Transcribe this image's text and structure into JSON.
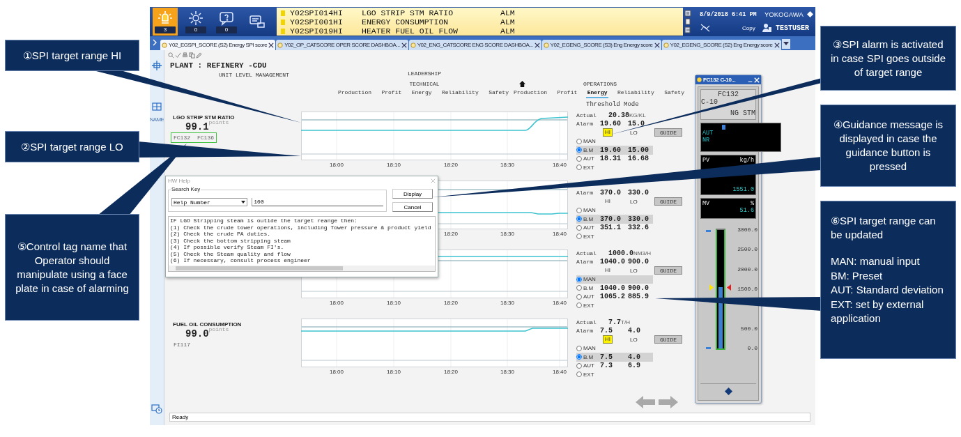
{
  "callouts": [
    {
      "text": "①SPI target range HI"
    },
    {
      "text": "②SPI target range LO"
    },
    {
      "text": "⑤Control tag name that Operator should manipulate using a face plate in case of alarming"
    },
    {
      "text": "③SPI alarm is activated in case SPI goes outside of target range"
    },
    {
      "text": "④Guidance message is displayed in case the guidance button is pressed"
    },
    {
      "text": "⑥SPI target range can be updated",
      "notes": [
        "MAN: manual input",
        "BM: Preset",
        "AUT: Standard deviation",
        "EXT: set by external application"
      ]
    }
  ],
  "alarm_buttons": [
    {
      "kind": "lamp",
      "count": "3",
      "active": true
    },
    {
      "kind": "sun",
      "count": "0",
      "active": false
    },
    {
      "kind": "help",
      "count": "0",
      "active": false
    },
    {
      "kind": "screen",
      "active": false
    }
  ],
  "alarms": [
    {
      "tag": "Y02SPI014HI",
      "description": "LGO STRIP STM RATIO",
      "status": "ALM"
    },
    {
      "tag": "Y02SPI001HI",
      "description": "ENERGY CONSUMPTION",
      "status": "ALM"
    },
    {
      "tag": "Y02SPI019HI",
      "description": "HEATER FUEL OIL FLOW",
      "status": "ALM"
    }
  ],
  "datetime": "8/9/2018 6:41 PM",
  "brand": "YOKOGAWA",
  "copy": "Copy",
  "user": "TESTUSER",
  "tabs": [
    {
      "label": "Y02_EGSPI_SCORE (S2) Energy SPI score",
      "selected": true
    },
    {
      "label": "Y02_OP_CATSCORE OPER SCORE DASHBOA...",
      "selected": false
    },
    {
      "label": "Y02_ENG_CATSCORE ENG SCORE DASHBOA...",
      "selected": false
    },
    {
      "label": "Y02_EGENG_SCORE (S3) Eng Energy score",
      "selected": false
    },
    {
      "label": "Y02_EGENG_SCORE (S2) Eng Energy score",
      "selected": false
    }
  ],
  "sidebar_label": "NAME",
  "header": {
    "plant": "PLANT : REFINERY -CDU",
    "subtitle": "UNIT LEVEL MANAGEMENT",
    "leadership": "LEADERSHIP",
    "groups": [
      {
        "label": "TECHNICAL",
        "items": [
          {
            "label": "Production",
            "selected": false
          },
          {
            "label": "Profit",
            "selected": false
          },
          {
            "label": "Energy",
            "selected": false
          },
          {
            "label": "Reliability",
            "selected": false
          },
          {
            "label": "Safety",
            "selected": false
          }
        ]
      },
      {
        "label": "OPERATIONS",
        "items": [
          {
            "label": "Production",
            "selected": false
          },
          {
            "label": "Profit",
            "selected": false
          },
          {
            "label": "Energy",
            "selected": true
          },
          {
            "label": "Reliability",
            "selected": false
          },
          {
            "label": "Safety",
            "selected": false
          }
        ]
      }
    ]
  },
  "threshold_mode": "Threshold Mode",
  "sections": [
    {
      "kind": "rise",
      "title": "LGO STRIP STM RATIO",
      "score": "99.1",
      "score_unit": "points",
      "tags": [
        "FC132",
        "FC136"
      ],
      "highlighted": true,
      "times": [
        "18:00",
        "18:10",
        "18:20",
        "18:30",
        "18:40"
      ],
      "actual": {
        "label": "Actual",
        "value": "20.38",
        "unit": "KG/KL"
      },
      "alarm": {
        "label": "Alarm",
        "hi": "19.60",
        "lo": "15.0",
        "hi_label": "HI",
        "lo_label": "LO",
        "hi_active": true
      },
      "guide": "GUIDE",
      "modes": [
        {
          "label": "MAN",
          "selected": false
        },
        {
          "label": "B.M",
          "selected": true,
          "hi": "19.60",
          "lo": "15.00"
        },
        {
          "label": "AUT",
          "selected": false,
          "hi": "18.31",
          "lo": "16.68"
        },
        {
          "label": "EXT",
          "selected": false
        }
      ]
    },
    {
      "kind": "flat_dip",
      "times": [
        "18:20",
        "18:30",
        "18:40"
      ],
      "alarm": {
        "label": "Alarm",
        "hi": "370.0",
        "lo": "330.0",
        "hi_label": "HI",
        "lo_label": "LO",
        "hi_active": false
      },
      "guide": "GUIDE",
      "modes": [
        {
          "label": "MAN",
          "selected": false
        },
        {
          "label": "B.M",
          "selected": true,
          "hi": "370.0",
          "lo": "330.0"
        },
        {
          "label": "AUT",
          "selected": false,
          "hi": "351.1",
          "lo": "332.6"
        },
        {
          "label": "EXT",
          "selected": false
        }
      ]
    },
    {
      "kind": "high",
      "times": [
        "18:00",
        "18:10",
        "18:20",
        "18:30",
        "18:40"
      ],
      "actual": {
        "label": "Actual",
        "value": "1000.0",
        "unit": "NM3/H"
      },
      "alarm": {
        "label": "Alarm",
        "hi": "1040.0",
        "lo": "900.0",
        "hi_label": "HI",
        "lo_label": "LO",
        "hi_active": false
      },
      "guide": "GUIDE",
      "modes": [
        {
          "label": "MAN",
          "selected": true
        },
        {
          "label": "B.M",
          "selected": false,
          "hi": "1040.0",
          "lo": "900.0"
        },
        {
          "label": "AUT",
          "selected": false,
          "hi": "1065.2",
          "lo": "885.9"
        },
        {
          "label": "EXT",
          "selected": false
        }
      ]
    },
    {
      "kind": "step_up",
      "title": "FUEL OIL CONSUMPTION",
      "score": "99.0",
      "score_unit": "points",
      "tags": [
        "FI117"
      ],
      "highlighted": false,
      "times": [
        "18:00",
        "18:10",
        "18:20",
        "18:30",
        "18:40"
      ],
      "actual": {
        "label": "Actual",
        "value": "7.7",
        "unit": "T/H"
      },
      "alarm": {
        "label": "Alarm",
        "hi": "7.5",
        "lo": "4.0",
        "hi_label": "HI",
        "lo_label": "LO",
        "hi_active": true
      },
      "guide": "GUIDE",
      "modes": [
        {
          "label": "MAN",
          "selected": false
        },
        {
          "label": "B.M",
          "selected": true,
          "hi": "7.5",
          "lo": "4.0"
        },
        {
          "label": "AUT",
          "selected": false,
          "hi": "7.3",
          "lo": "6.9"
        },
        {
          "label": "EXT",
          "selected": false
        }
      ]
    }
  ],
  "faceplate": {
    "title": "FC132 C-10...",
    "tag": "FC132",
    "desc_1": "C-10",
    "desc_2": "NG STM",
    "mode": "AUT",
    "status": "NR",
    "pv_label": "PV",
    "pv_unit": "kg/h",
    "pv": "1551.0",
    "mv_label": "MV",
    "mv_unit": "%",
    "mv": "51.6",
    "pv_bar": {
      "level": 0.52
    },
    "scale": [
      "3000.0",
      "2500.0",
      "2000.0",
      "1500.0",
      "500.0",
      "0.0"
    ]
  },
  "help": {
    "title": "HW Help",
    "group": "Search Key",
    "select": "Help Number",
    "value": "100",
    "buttons": [
      "Display",
      "Cancel"
    ],
    "lines": [
      "IF LGO Stripping steam is outide the target reange then:",
      "(1) Check the crude tower operations, including Tower pressure & product yield",
      "(2) Check the crude PA duties.",
      "(3) Check the bottom stripping steam",
      "(4) If possible verify Steam FI's.",
      "(5) Check the Steam quality and flow",
      "(6) If necessary, consult process engineer"
    ]
  },
  "status": "Ready"
}
